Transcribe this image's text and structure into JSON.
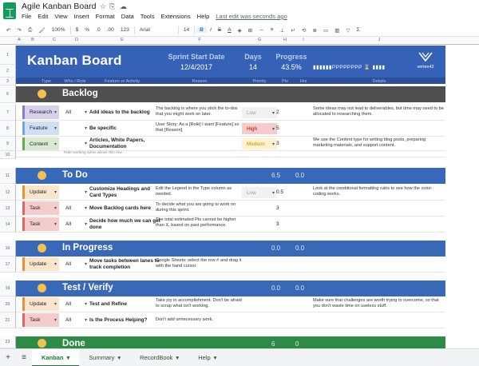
{
  "window": {
    "title": "Agile Kanban Board",
    "last_edit": "Last edit was seconds ago"
  },
  "menu": [
    "File",
    "Edit",
    "View",
    "Insert",
    "Format",
    "Data",
    "Tools",
    "Extensions",
    "Help"
  ],
  "toolbar": {
    "zoom": "100%",
    "currency": "$",
    "percent": "%",
    "decimals_dec": ".0",
    "decimals_inc": ".00",
    "format_more": "123",
    "font": "Arial",
    "font_size": "14",
    "bold": "B",
    "italic": "I",
    "strike": "S",
    "text_color": "A"
  },
  "columns": [
    "A",
    "B",
    "C",
    "D",
    "E",
    "F",
    "G",
    "H",
    "I",
    "J"
  ],
  "header": {
    "title": "Kanban Board",
    "sprint_label": "Sprint Start Date",
    "sprint_value": "12/4/2017",
    "days_label": "Days",
    "days_value": "14",
    "progress_label": "Progress",
    "progress_value": "43.5%",
    "progress_bar": "▮▮▮▮▮▮PPPPPPPP ⌛ ▮▮▮▮",
    "brand": "vertex42",
    "sub_cols": {
      "type": "Type",
      "who": "Who / Role",
      "feature": "Feature or Activity",
      "reason": "Reason",
      "priority": "Priority",
      "pts": "Pts",
      "hrs": "Hrs",
      "details": "Details"
    }
  },
  "lanes": [
    {
      "name": "Backlog",
      "pts": "",
      "hrs": "",
      "color": "#4f4f4f"
    },
    {
      "name": "To Do",
      "pts": "6.5",
      "hrs": "0.0",
      "color": "#3a68b8"
    },
    {
      "name": "In Progress",
      "pts": "0.0",
      "hrs": "0.0",
      "color": "#3a68b8"
    },
    {
      "name": "Test / Verify",
      "pts": "0.0",
      "hrs": "0.0",
      "color": "#3a68b8"
    },
    {
      "name": "Done",
      "pts": "6",
      "hrs": "0",
      "color": "#2e8b47"
    }
  ],
  "rows": {
    "r1": {
      "type": "Research",
      "who": "All",
      "feature": "Add ideas to the backlog",
      "reason": "The backlog is where you stick the to-dos that you might work on later.",
      "priority": "Low",
      "pts": "2",
      "details": "Some ideas may not lead to deliverables, but time may need to be allocated to researching them."
    },
    "r2": {
      "type": "Feature",
      "who": "",
      "feature": "Be specific",
      "reason": "User Story: As a [Role] I want [Feature] so that [Reason]",
      "priority": "High",
      "pts": "5",
      "details": ""
    },
    "r3": {
      "type": "Content",
      "who": "",
      "feature": "Articles, White Papers, Documentation",
      "reason": "",
      "priority": "Medium",
      "pts": "3",
      "details": "We use the Content type for writing blog posts, preparing marketing materials, and support content."
    },
    "note1": "Hide working items above this row",
    "r4": {
      "type": "Update",
      "who": "",
      "feature": "Customize Headings and Card Types",
      "reason": "Edit the Legend in the Type column as needed.",
      "priority": "Low",
      "pts": "0.5",
      "details": "Look at the conditional formatting rules to see how the color-coding works."
    },
    "r5": {
      "type": "Task",
      "who": "All",
      "feature": "Move Backlog cards here",
      "reason": "To decide what you are going to work on during this sprint.",
      "priority": "",
      "pts": "3",
      "details": ""
    },
    "r6": {
      "type": "Task",
      "who": "All",
      "feature": "Decide how much we can get done",
      "reason": "The total estimated Pts cannot be higher than X, based on past performance.",
      "priority": "",
      "pts": "3",
      "details": ""
    },
    "r7": {
      "type": "Update",
      "who": "All",
      "feature": "Move tasks between lanes to track completion",
      "reason": "Google Sheets: select the row # and drag it with the hand cursor.",
      "priority": "",
      "pts": "",
      "details": ""
    },
    "r8": {
      "type": "Update",
      "who": "All",
      "feature": "Test and Refine",
      "reason": "Take joy in accomplishment. Don't be afraid to scrap what isn't working.",
      "priority": "",
      "pts": "",
      "details": "Make sure that challenges are worth trying to overcome, so that you don't waste time on useless stuff."
    },
    "r9": {
      "type": "Task",
      "who": "All",
      "feature": "Is the Process Helping?",
      "reason": "Don't add unnecessary work.",
      "priority": "",
      "pts": "",
      "details": ""
    }
  },
  "tabs": {
    "add": "+",
    "list": "≡",
    "t1": "Kanban",
    "t2": "Summary",
    "t3": "RecordBook",
    "t4": "Help"
  }
}
